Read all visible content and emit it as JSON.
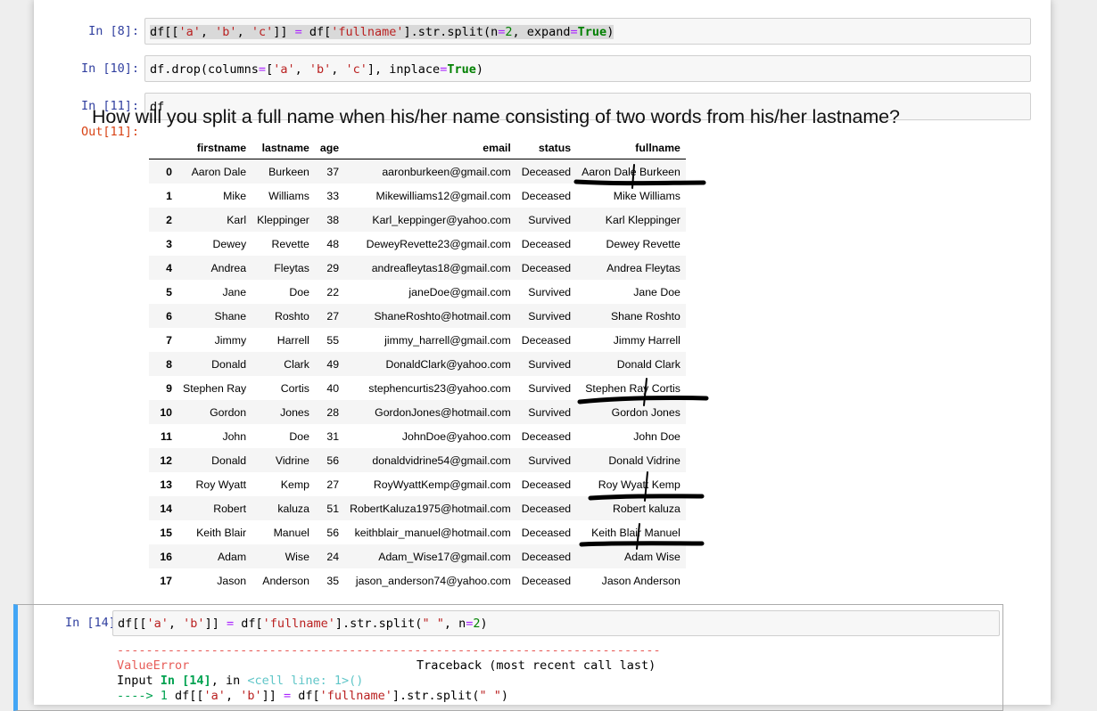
{
  "cells": [
    {
      "prompt": "In [8]:",
      "code": {
        "t1": "df[[",
        "s1": "'a'",
        "t2": ", ",
        "s2": "'b'",
        "t3": ", ",
        "s3": "'c'",
        "t4": "]] ",
        "op1": "=",
        "t5": " df[",
        "s4": "'fullname'",
        "t6": "].str.split(n",
        "op2": "=",
        "n1": "2",
        "t7": ", expand",
        "op3": "=",
        "kw1": "True",
        "t8": ")"
      }
    },
    {
      "prompt": "In [10]:",
      "code": {
        "t1": "df.drop(columns",
        "op1": "=",
        "t2": "[",
        "s1": "'a'",
        "t3": ", ",
        "s2": "'b'",
        "t4": ", ",
        "s3": "'c'",
        "t5": "], inplace",
        "op2": "=",
        "kw1": "True",
        "t6": ")"
      }
    },
    {
      "prompt": "In [11]:",
      "code": {
        "t1": "df"
      },
      "out_prompt": "Out[11]:"
    }
  ],
  "question": "How will you split a full name when his/her name consisting of two words from his/her lastname?",
  "table": {
    "columns": [
      "",
      "firstname",
      "lastname",
      "age",
      "email",
      "status",
      "fullname"
    ],
    "rows": [
      [
        "0",
        "Aaron Dale",
        "Burkeen",
        "37",
        "aaronburkeen@gmail.com",
        "Deceased",
        "Aaron Dale Burkeen"
      ],
      [
        "1",
        "Mike",
        "Williams",
        "33",
        "Mikewilliams12@gmail.com",
        "Deceased",
        "Mike Williams"
      ],
      [
        "2",
        "Karl",
        "Kleppinger",
        "38",
        "Karl_keppinger@yahoo.com",
        "Survived",
        "Karl Kleppinger"
      ],
      [
        "3",
        "Dewey",
        "Revette",
        "48",
        "DeweyRevette23@gmail.com",
        "Deceased",
        "Dewey Revette"
      ],
      [
        "4",
        "Andrea",
        "Fleytas",
        "29",
        "andreafleytas18@gmail.com",
        "Deceased",
        "Andrea Fleytas"
      ],
      [
        "5",
        "Jane",
        "Doe",
        "22",
        "janeDoe@gmail.com",
        "Survived",
        "Jane Doe"
      ],
      [
        "6",
        "Shane",
        "Roshto",
        "27",
        "ShaneRoshto@hotmail.com",
        "Survived",
        "Shane Roshto"
      ],
      [
        "7",
        "Jimmy",
        "Harrell",
        "55",
        "jimmy_harrell@gmail.com",
        "Deceased",
        "Jimmy Harrell"
      ],
      [
        "8",
        "Donald",
        "Clark",
        "49",
        "DonaldClark@yahoo.com",
        "Survived",
        "Donald Clark"
      ],
      [
        "9",
        "Stephen Ray",
        "Cortis",
        "40",
        "stephencurtis23@yahoo.com",
        "Survived",
        "Stephen Ray Cortis"
      ],
      [
        "10",
        "Gordon",
        "Jones",
        "28",
        "GordonJones@hotmail.com",
        "Survived",
        "Gordon Jones"
      ],
      [
        "11",
        "John",
        "Doe",
        "31",
        "JohnDoe@yahoo.com",
        "Deceased",
        "John Doe"
      ],
      [
        "12",
        "Donald",
        "Vidrine",
        "56",
        "donaldvidrine54@gmail.com",
        "Survived",
        "Donald Vidrine"
      ],
      [
        "13",
        "Roy Wyatt",
        "Kemp",
        "27",
        "RoyWyattKemp@gmail.com",
        "Deceased",
        "Roy Wyatt Kemp"
      ],
      [
        "14",
        "Robert",
        "kaluza",
        "51",
        "RobertKaluza1975@hotmail.com",
        "Deceased",
        "Robert kaluza"
      ],
      [
        "15",
        "Keith Blair",
        "Manuel",
        "56",
        "keithblair_manuel@hotmail.com",
        "Deceased",
        "Keith Blair Manuel"
      ],
      [
        "16",
        "Adam",
        "Wise",
        "24",
        "Adam_Wise17@gmail.com",
        "Deceased",
        "Adam Wise"
      ],
      [
        "17",
        "Jason",
        "Anderson",
        "35",
        "jason_anderson74@yahoo.com",
        "Deceased",
        "Jason Anderson"
      ]
    ]
  },
  "active_cell": {
    "prompt": "In [14]:",
    "code": {
      "t1": "df[[",
      "s1": "'a'",
      "t2": ", ",
      "s2": "'b'",
      "t3": "]] ",
      "op1": "=",
      "t4": " df[",
      "s3": "'fullname'",
      "t5": "].str.split(",
      "s4": "\" \"",
      "t6": ", n",
      "op2": "=",
      "n1": "2",
      "t7": ")"
    },
    "traceback": {
      "dashes": "---------------------------------------------------------------------------",
      "error_name": "ValueError",
      "traceback_label": "Traceback (most recent call last)",
      "input_word": "Input ",
      "in_ref": "In [14]",
      "in_word": ", in ",
      "cell_line": "<cell line: 1>",
      "parens": "()",
      "arrow": "----> 1",
      "line_code": {
        "t1": " df[[",
        "s1": "'a'",
        "t2": ", ",
        "s2": "'b'",
        "t3": "]] ",
        "op1": "=",
        "t4": " df[",
        "s3": "'fullname'",
        "t5": "].str.split(",
        "s4": "\" \"",
        "t6": ")"
      }
    }
  },
  "colors": {
    "in_prompt": "#303f9f",
    "out_prompt": "#d84315",
    "active_border": "#42a5f5",
    "annotation": "#000000"
  }
}
